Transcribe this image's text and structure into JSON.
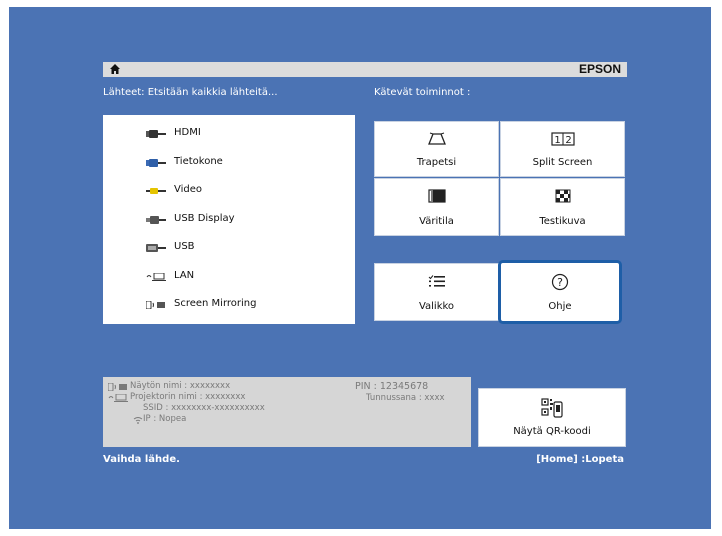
{
  "header": {
    "brand": "EPSON",
    "home_icon": "home-icon"
  },
  "sources": {
    "heading": "Lähteet: Etsitään kaikkia lähteitä...",
    "items": [
      {
        "label": "HDMI",
        "icon": "hdmi-icon"
      },
      {
        "label": "Tietokone",
        "icon": "computer-port-icon"
      },
      {
        "label": "Video",
        "icon": "video-port-icon"
      },
      {
        "label": "USB Display",
        "icon": "usb-display-icon"
      },
      {
        "label": "USB",
        "icon": "usb-icon"
      },
      {
        "label": "LAN",
        "icon": "lan-icon"
      },
      {
        "label": "Screen Mirroring",
        "icon": "screen-mirroring-icon"
      }
    ]
  },
  "functions": {
    "heading": "Kätevät toiminnot :",
    "tiles": [
      {
        "label": "Trapetsi",
        "icon": "keystone-icon"
      },
      {
        "label": "Split Screen",
        "icon": "split-screen-icon",
        "icon_text": "1 2"
      },
      {
        "label": "Väritila",
        "icon": "color-mode-icon"
      },
      {
        "label": "Testikuva",
        "icon": "test-pattern-icon"
      },
      {
        "label": "Valikko",
        "icon": "menu-icon"
      },
      {
        "label": "Ohje",
        "icon": "help-icon",
        "selected": true
      }
    ]
  },
  "info": {
    "display_name": "Näytön nimi :  xxxxxxxx",
    "projector_name": "Projektorin nimi :  xxxxxxxx",
    "ssid": "SSID  :  xxxxxxxx-xxxxxxxxxx",
    "ip": "IP  :  Nopea",
    "pin": "PIN :  12345678",
    "password": "Tunnussana :  xxxx"
  },
  "qr": {
    "label": "Näytä QR-koodi",
    "icon": "qr-code-icon"
  },
  "footer": {
    "left": "Vaihda lähde.",
    "right": "[Home] :Lopeta"
  },
  "colors": {
    "background": "#4b73b4",
    "selection": "#1e5ea7",
    "panel": "#ffffff",
    "info_panel": "#d6d6d6"
  }
}
